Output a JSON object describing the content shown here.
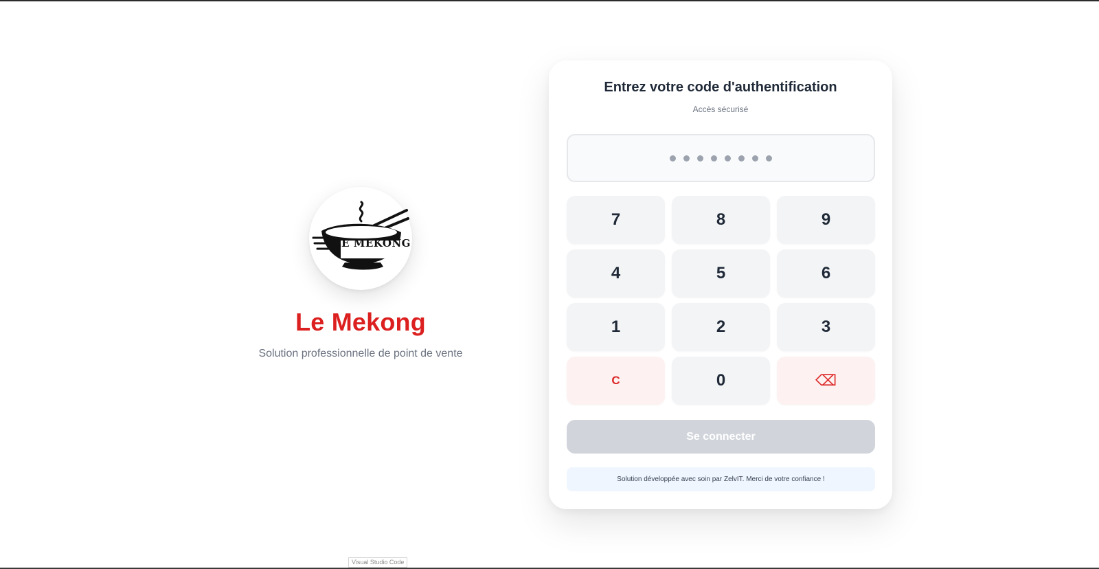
{
  "brand": {
    "name": "Le Mekong",
    "tagline": "Solution professionnelle de point de vente",
    "logo_text": "LE MEKONG"
  },
  "auth": {
    "title": "Entrez votre code d'authentification",
    "subtitle": "Accès sécurisé",
    "code_length": 8,
    "keys": {
      "k7": "7",
      "k8": "8",
      "k9": "9",
      "k4": "4",
      "k5": "5",
      "k6": "6",
      "k1": "1",
      "k2": "2",
      "k3": "3",
      "clear": "C",
      "k0": "0",
      "backspace": "⌫"
    },
    "submit_label": "Se connecter",
    "footer": "Solution développée avec soin par ZelvIT. Merci de votre confiance !"
  },
  "taskbar_tooltip": "Visual Studio Code",
  "colors": {
    "brand_red": "#dc1f1f",
    "key_bg": "#f3f4f6",
    "danger_bg": "#fef1f1",
    "disabled_button": "#d1d5db",
    "info_bg": "#eff6ff"
  }
}
